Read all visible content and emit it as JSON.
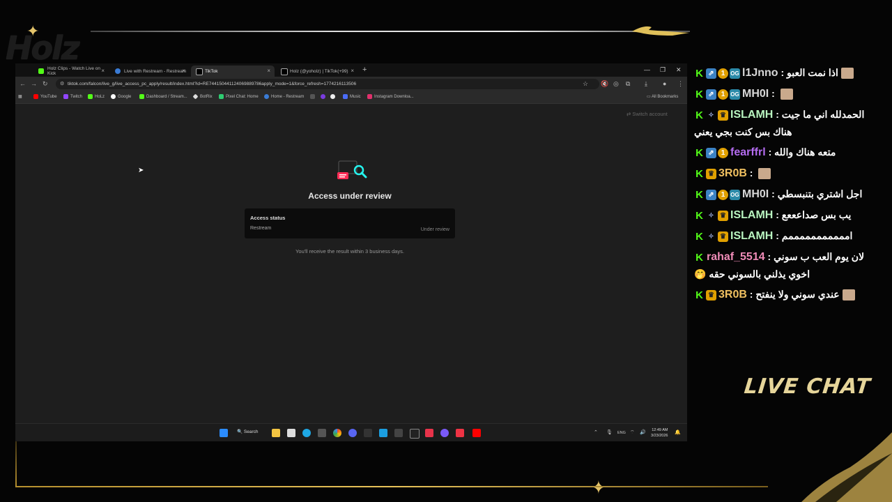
{
  "overlay": {
    "brand_logo": "Holz",
    "live_chat_label": "LIVE CHAT"
  },
  "browser": {
    "tabs": [
      {
        "label": "Holz Clips - Watch Live on Kick",
        "color": "#53fc18"
      },
      {
        "label": "Live with Restream - Restream",
        "color": "#3a7bd5"
      },
      {
        "label": "TikTok",
        "color": "#ffffff"
      },
      {
        "label": "Holz (@yoholz) | TikTok(+99)",
        "color": "#ffffff"
      }
    ],
    "url": "tiktok.com/falcon/live_g/live_access_pc_apply/result/index.html?id=RE744150441124069889786apply_mode=1&force_refresh=1774216113506",
    "bookmarks": [
      {
        "label": "YouTube",
        "color": "#ff0000"
      },
      {
        "label": "Twitch",
        "color": "#9146ff"
      },
      {
        "label": "HoLz",
        "color": "#53fc18"
      },
      {
        "label": "Google",
        "color": "#4285f4"
      },
      {
        "label": "Dashboard / Stream...",
        "color": "#53fc18"
      },
      {
        "label": "BotRix",
        "color": "#ffffff"
      },
      {
        "label": "Pixel Chat: Home",
        "color": "#2ecc71"
      },
      {
        "label": "Home - Restream",
        "color": "#3a7bd5"
      },
      {
        "label": "Music",
        "color": "#4a6cf7"
      },
      {
        "label": "Instagram Downloa...",
        "color": "#e1306c"
      }
    ],
    "all_bookmarks": "All Bookmarks"
  },
  "page": {
    "switch_account": "Switch account",
    "title": "Access under review",
    "status_heading": "Access status",
    "status_name": "Restream",
    "status_value": "Under review",
    "note": "You'll receive the result within 3 business days."
  },
  "taskbar": {
    "search_label": "Search",
    "lang": "ENG",
    "time": "12:49 AM",
    "date": "3/23/2026"
  },
  "chat": {
    "messages": [
      {
        "badges": [
          "kick",
          "sub",
          "one",
          "og"
        ],
        "user": "l1Jnno",
        "user_color": "#d8d8d8",
        "text": "اذا نمت العبو",
        "emote": true
      },
      {
        "badges": [
          "kick",
          "sub",
          "one",
          "og"
        ],
        "user": "MH0I",
        "user_color": "#d8d8d8",
        "text": "",
        "emote": true
      },
      {
        "badges": [
          "kick",
          "vip",
          "crown"
        ],
        "user": "ISLAMH",
        "user_color": "#b9f5c0",
        "text": "الحمدلله اني ما جيت هناك بس كنت بجي يعني",
        "emote": false
      },
      {
        "badges": [
          "kick",
          "sub",
          "one"
        ],
        "user": "fearffrl",
        "user_color": "#b46cf0",
        "text": "متعه هناك والله",
        "emote": false
      },
      {
        "badges": [
          "kick",
          "crown"
        ],
        "user": "3R0B",
        "user_color": "#f0c060",
        "text": "",
        "emote": true
      },
      {
        "badges": [
          "kick",
          "sub",
          "one",
          "og"
        ],
        "user": "MH0I",
        "user_color": "#d8d8d8",
        "text": "اجل اشتري بتنبسطي",
        "emote": false
      },
      {
        "badges": [
          "kick",
          "vip",
          "crown"
        ],
        "user": "ISLAMH",
        "user_color": "#b9f5c0",
        "text": "يب بس صداعععع",
        "emote": false
      },
      {
        "badges": [
          "kick",
          "vip",
          "crown"
        ],
        "user": "ISLAMH",
        "user_color": "#b9f5c0",
        "text": "امممممممممممم",
        "emote": false
      },
      {
        "badges": [
          "kick"
        ],
        "user": "rahaf_5514",
        "user_color": "#f08cb8",
        "text": "لان يوم العب ب سوني اخوي يذلني بالسوني حقه 🤭",
        "emote": false
      },
      {
        "badges": [
          "kick",
          "crown"
        ],
        "user": "3R0B",
        "user_color": "#f0c060",
        "text": "عندي سوني ولا ينفتح",
        "emote": true
      }
    ]
  }
}
